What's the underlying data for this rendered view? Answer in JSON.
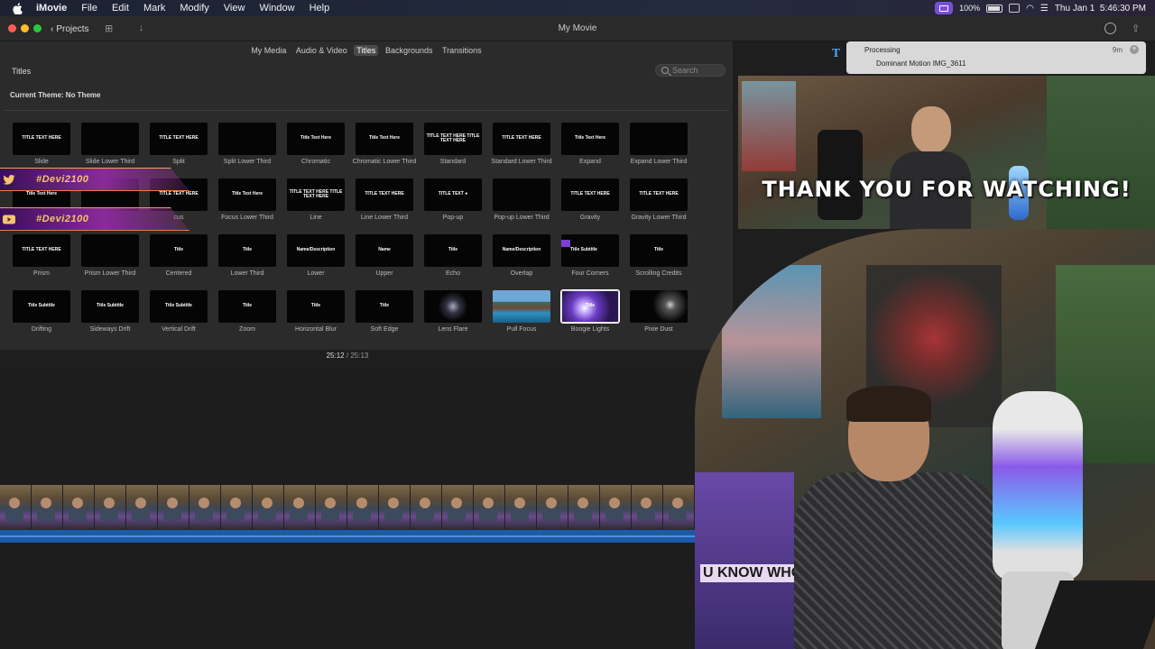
{
  "menubar": {
    "items": [
      "iMovie",
      "File",
      "Edit",
      "Mark",
      "Modify",
      "View",
      "Window",
      "Help"
    ],
    "battery": "100%",
    "datetime": "Thu Jan 1  5:46:30 PM"
  },
  "window": {
    "title": "My Movie",
    "projects_label": "Projects"
  },
  "browser": {
    "tabs": [
      "My Media",
      "Audio & Video",
      "Titles",
      "Backgrounds",
      "Transitions"
    ],
    "active_tab": "Titles",
    "section_title": "Titles",
    "search_placeholder": "Search",
    "theme_label": "Current Theme: No Theme",
    "tiles": [
      {
        "label": "Slide",
        "thumb": "TITLE TEXT HERE"
      },
      {
        "label": "Slide Lower Third",
        "thumb": ""
      },
      {
        "label": "Split",
        "thumb": "TITLE TEXT HERE"
      },
      {
        "label": "Split Lower Third",
        "thumb": ""
      },
      {
        "label": "Chromatic",
        "thumb": "Title Text Here"
      },
      {
        "label": "Chromatic Lower Third",
        "thumb": "Title Text Here"
      },
      {
        "label": "Standard",
        "thumb": "TITLE TEXT HERE TITLE TEXT HERE"
      },
      {
        "label": "Standard Lower Third",
        "thumb": "TITLE TEXT HERE"
      },
      {
        "label": "Expand",
        "thumb": "Title Text Here"
      },
      {
        "label": "Expand Lower Third",
        "thumb": ""
      },
      {
        "label": "",
        "thumb": "Title Text Here"
      },
      {
        "label": "",
        "thumb": ""
      },
      {
        "label": "cus",
        "thumb": "TITLE TEXT HERE"
      },
      {
        "label": "Focus Lower Third",
        "thumb": "Title Text Here"
      },
      {
        "label": "Line",
        "thumb": "TITLE TEXT HERE TITLE TEXT HERE"
      },
      {
        "label": "Line Lower Third",
        "thumb": "TITLE TEXT HERE"
      },
      {
        "label": "Pop-up",
        "thumb": "TITLE TEXT ●"
      },
      {
        "label": "Pop-up Lower Third",
        "thumb": ""
      },
      {
        "label": "Gravity",
        "thumb": "TITLE TEXT HERE"
      },
      {
        "label": "Gravity Lower Third",
        "thumb": "TITLE TEXT HERE"
      },
      {
        "label": "Prism",
        "thumb": "TITLE TEXT HERE"
      },
      {
        "label": "Prism Lower Third",
        "thumb": ""
      },
      {
        "label": "Centered",
        "thumb": "Title"
      },
      {
        "label": "Lower Third",
        "thumb": "Title"
      },
      {
        "label": "Lower",
        "thumb": "Name/Description"
      },
      {
        "label": "Upper",
        "thumb": "Name"
      },
      {
        "label": "Echo",
        "thumb": "Title"
      },
      {
        "label": "Overlap",
        "thumb": "Name/Description"
      },
      {
        "label": "Four Corners",
        "thumb": "Title Subtitle"
      },
      {
        "label": "Scrolling Credits",
        "thumb": "Title"
      },
      {
        "label": "Drifting",
        "thumb": "Title Subtitle"
      },
      {
        "label": "Sideways Drift",
        "thumb": "Title Subtitle"
      },
      {
        "label": "Vertical Drift",
        "thumb": "Title Subtitle"
      },
      {
        "label": "Zoom",
        "thumb": "Title"
      },
      {
        "label": "Horizontal Blur",
        "thumb": "Title"
      },
      {
        "label": "Soft Edge",
        "thumb": "Title"
      },
      {
        "label": "Lens Flare",
        "thumb": ""
      },
      {
        "label": "Pull Focus",
        "thumb": ""
      },
      {
        "label": "Boogie Lights",
        "thumb": "Title"
      },
      {
        "label": "Pixie Dust",
        "thumb": ""
      }
    ]
  },
  "overlay": {
    "twitter_handle": "#Devi2100",
    "youtube_handle": "#Devi2100"
  },
  "timecode": {
    "current": "25:12",
    "sep": "/",
    "total": "25:13"
  },
  "processing": {
    "label": "Processing",
    "item": "Dominant Motion IMG_3611",
    "eta": "9m"
  },
  "viewer": {
    "caption": "THANK YOU FOR WATCHING!"
  },
  "camera": {
    "box_text": "U KNOW WHO"
  },
  "colors": {
    "accent": "#7a4fd6",
    "wave": "#1f5aa8"
  }
}
